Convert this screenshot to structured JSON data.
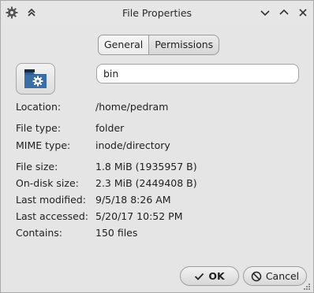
{
  "window": {
    "title": "File Properties"
  },
  "titlebar": {
    "menu_icon": "gear-icon",
    "keep_above_icon": "double-chevron-up-icon",
    "minimize_icon": "chevron-down-icon",
    "maximize_icon": "chevron-up-icon",
    "close_icon": "close-icon"
  },
  "tabs": [
    {
      "label": "General",
      "active": true
    },
    {
      "label": "Permissions",
      "active": false
    }
  ],
  "folder_icon": "folder-settings-icon",
  "name_field": {
    "value": "bin"
  },
  "properties": {
    "location": {
      "label": "Location:",
      "value": "/home/pedram"
    },
    "file_type": {
      "label": "File type:",
      "value": "folder"
    },
    "mime_type": {
      "label": "MIME type:",
      "value": "inode/directory"
    },
    "file_size": {
      "label": "File size:",
      "value": "1.8 MiB (1935957 B)"
    },
    "disk_size": {
      "label": "On-disk size:",
      "value": "2.3 MiB (2449408 B)"
    },
    "last_modified": {
      "label": "Last modified:",
      "value": "9/5/18 8:26 AM"
    },
    "last_accessed": {
      "label": "Last accessed:",
      "value": "5/20/17 10:52 PM"
    },
    "contains": {
      "label": "Contains:",
      "value": "150 files"
    }
  },
  "buttons": {
    "ok": {
      "label": "OK",
      "icon": "checkmark-icon"
    },
    "cancel": {
      "label": "Cancel",
      "icon": "cancel-icon"
    }
  },
  "colors": {
    "window_bg": "#e5e5e5",
    "folder_blue": "#3b6ea5"
  }
}
